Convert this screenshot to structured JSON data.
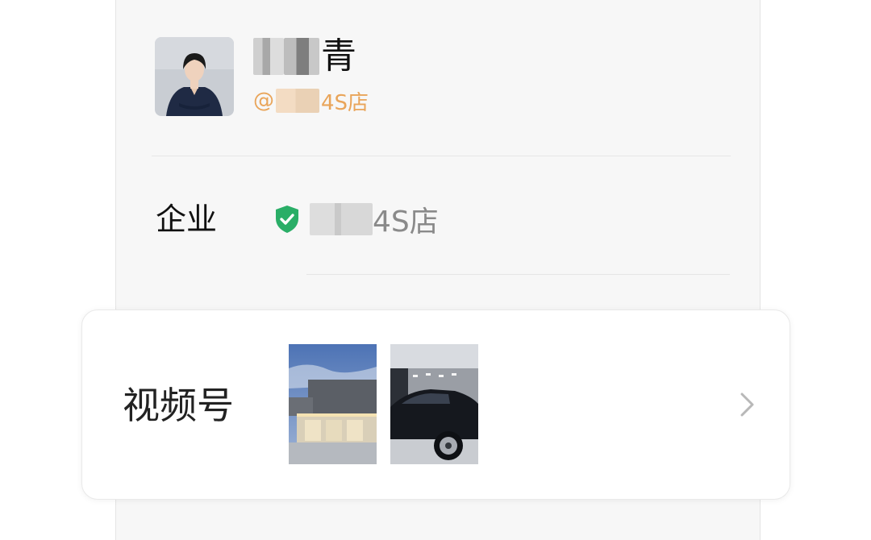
{
  "profile": {
    "name_visible_char": "青",
    "corp_prefix": "@",
    "corp_suffix": "4S店"
  },
  "enterprise": {
    "label": "企业",
    "verified_icon": "shield-check-icon",
    "verified_suffix": "4S店"
  },
  "channels": {
    "label": "视频号",
    "thumbnails": [
      "showroom-building-thumbnail",
      "car-in-showroom-thumbnail"
    ],
    "more_icon": "chevron-right-icon"
  },
  "colors": {
    "accent_orange": "#e9a55a",
    "verified_green": "#2aae67",
    "card_background": "#f7f7f7"
  }
}
